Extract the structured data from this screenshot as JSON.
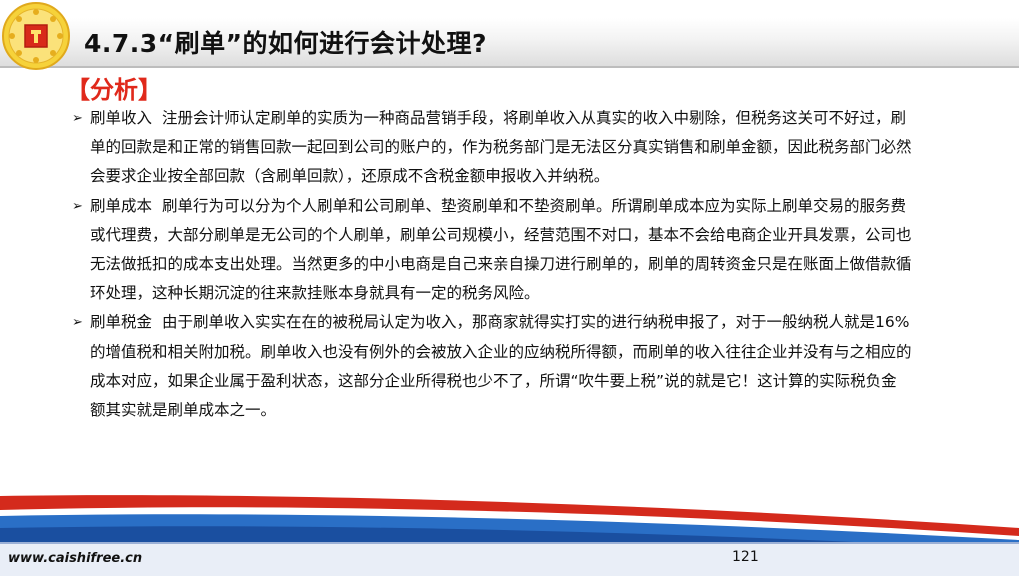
{
  "header": {
    "title": "4.7.3“刷单”的如何进行会计处理?",
    "section": "【分析】"
  },
  "bullets": [
    {
      "head": "刷单收入",
      "text": "注册会计师认定刷单的实质为一种商品营销手段，将刷单收入从真实的收入中剔除，但税务这关可不好过，刷单的回款是和正常的销售回款一起回到公司的账户的，作为税务部门是无法区分真实销售和刷单金额，因此税务部门必然会要求企业按全部回款（含刷单回款），还原成不含税金额申报收入并纳税。"
    },
    {
      "head": "刷单成本",
      "text": "刷单行为可以分为个人刷单和公司刷单、垫资刷单和不垫资刷单。所谓刷单成本应为实际上刷单交易的服务费或代理费，大部分刷单是无公司的个人刷单，刷单公司规模小，经营范围不对口，基本不会给电商企业开具发票，公司也无法做抵扣的成本支出处理。当然更多的中小电商是自己来亲自操刀进行刷单的，刷单的周转资金只是在账面上做借款循环处理，这种长期沉淀的往来款挂账本身就具有一定的税务风险。"
    },
    {
      "head": "刷单税金",
      "text": "由于刷单收入实实在在的被税局认定为收入，那商家就得实打实的进行纳税申报了，对于一般纳税人就是16%的增值税和相关附加税。刷单收入也没有例外的会被放入企业的应纳税所得额，而刷单的收入往往企业并没有与之相应的成本对应，如果企业属于盈利状态，这部分企业所得税也少不了，所谓“吹牛要上税”说的就是它！这计算的实际税负金额其实就是刷单成本之一。"
    }
  ],
  "footer": {
    "url": "www.caishifree.cn",
    "page_number": "121"
  },
  "colors": {
    "accent_red": "#e0291b",
    "accent_blue": "#1f5fb4",
    "logo_gold": "#f2c12e"
  }
}
